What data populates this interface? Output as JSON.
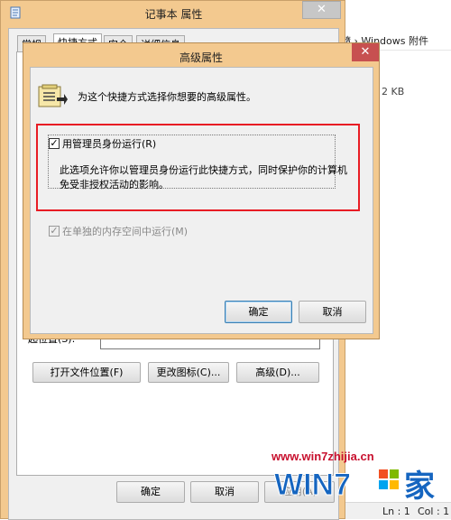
{
  "background_explorer": {
    "breadcrumb": "隨 › Windows 附件",
    "file_size": "2 KB",
    "status_bar": {
      "line": "Ln : 1",
      "col": "Col : 1"
    }
  },
  "properties_dialog": {
    "title": "记事本 属性",
    "close_symbol": "✕",
    "tabs": [
      {
        "label": "常规"
      },
      {
        "label": "快捷方式"
      },
      {
        "label": "安全"
      },
      {
        "label": "详细信息"
      }
    ],
    "field_label": "起位置(S):",
    "buttons": {
      "open_file_location": "打开文件位置(F)",
      "change_icon": "更改图标(C)...",
      "advanced": "高级(D)...",
      "ok": "确定",
      "cancel": "取消",
      "apply": "应用(A)"
    }
  },
  "advanced_dialog": {
    "title": "高级属性",
    "close_symbol": "✕",
    "description": "为这个快捷方式选择你想要的高级属性。",
    "run_as_admin": {
      "label": "用管理员身份运行(R)",
      "checked": true,
      "description": "此选项允许你以管理员身份运行此快捷方式，同时保护你的计算机免受非授权活动的影响。"
    },
    "separate_memory": {
      "label": "在单独的内存空间中运行(M)",
      "checked": true,
      "enabled": false
    },
    "buttons": {
      "ok": "确定",
      "cancel": "取消"
    }
  },
  "watermark": {
    "url": "www.win7zhijia.cn",
    "logo_text": "WIN7",
    "logo_suffix": "家"
  },
  "colors": {
    "window_frame": "#f3c98f",
    "highlight_border": "#e81c24",
    "close_button": "#c75050",
    "watermark_red": "#c8102e",
    "watermark_blue": "#1565c0"
  }
}
